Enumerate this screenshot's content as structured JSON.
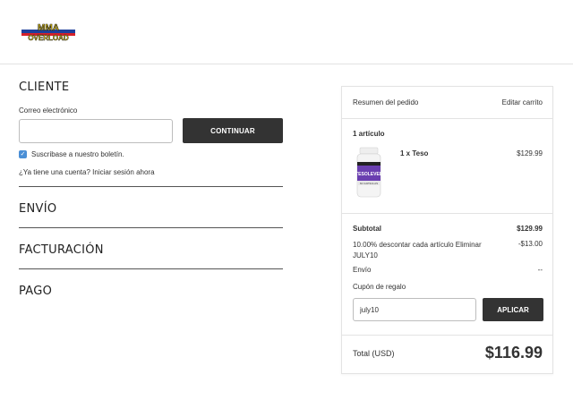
{
  "header": {
    "logo_text_top": "MMA",
    "logo_text_bottom": "OVERLOAD"
  },
  "customer": {
    "title": "CLIENTE",
    "email_label": "Correo electrónico",
    "email_value": "",
    "continue_label": "CONTINUAR",
    "newsletter_label": "Suscribase a nuestro boletín.",
    "newsletter_checked": true,
    "signin_question": "¿Ya tiene una cuenta?",
    "signin_link": "Iniciar sesión ahora"
  },
  "steps": {
    "shipping": "ENVÍO",
    "billing": "FACTURACIÓN",
    "payment": "PAGO"
  },
  "summary": {
    "title": "Resumen del pedido",
    "edit_cart": "Editar carrito",
    "items_count": "1 artículo",
    "item": {
      "name": "1 x Teso",
      "price": "$129.99",
      "image_label": "TESOLEVEL",
      "image_caption": "60 CAPSULAS"
    },
    "subtotal_label": "Subtotal",
    "subtotal_value": "$129.99",
    "discount_label": "10.00% descontar cada artículo Eliminar JULY10",
    "discount_value": "-$13.00",
    "shipping_label": "Envío",
    "shipping_value": "--",
    "coupon_label": "Cupón de regalo",
    "coupon_value": "july10",
    "apply_label": "APLICAR",
    "total_label": "Total (USD)",
    "total_value": "$116.99"
  },
  "colors": {
    "button_bg": "#333333",
    "checkbox": "#4a8fd6",
    "logo_yellow": "#f5d20a",
    "logo_red": "#d6202a",
    "logo_blue": "#1e3f9c"
  }
}
